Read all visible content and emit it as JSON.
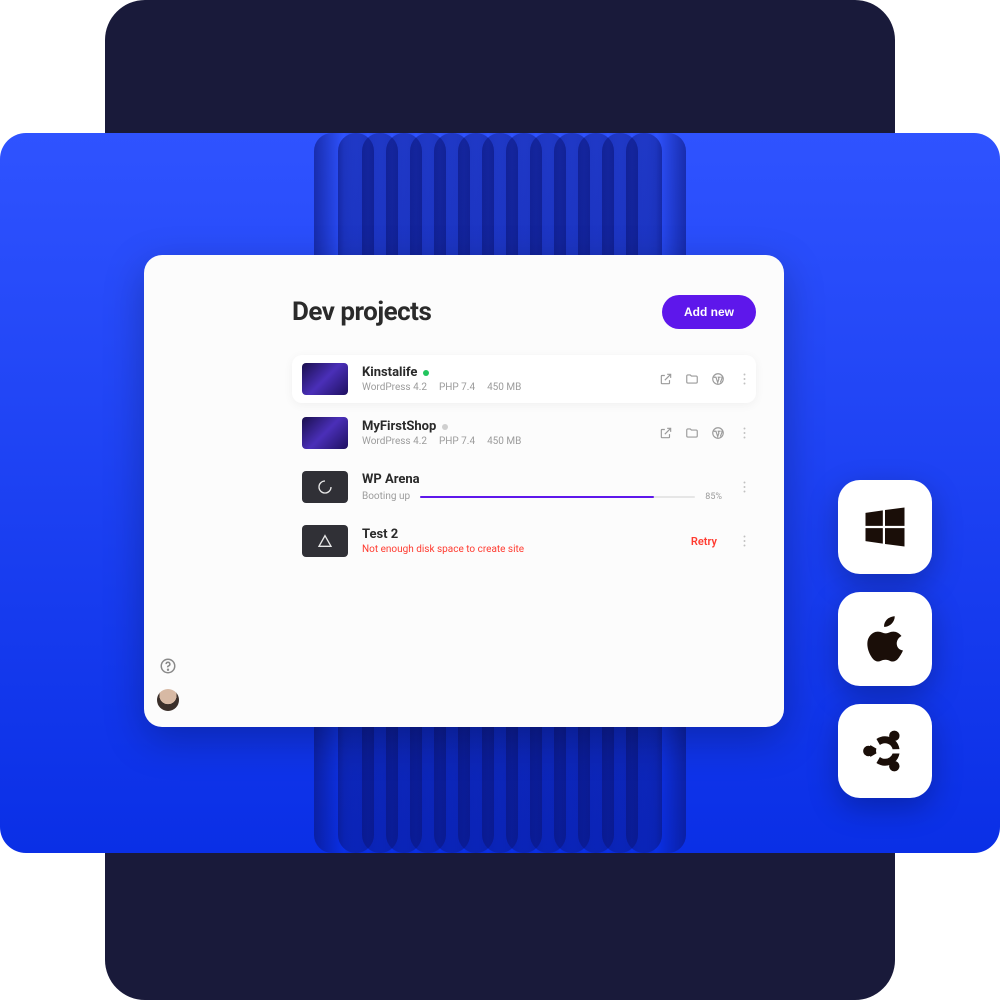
{
  "header": {
    "title": "Dev projects",
    "add_button": "Add new"
  },
  "projects": [
    {
      "name": "Kinstalife",
      "status": "green",
      "meta": {
        "wp": "WordPress 4.2",
        "php": "PHP 7.4",
        "size": "450 MB"
      }
    },
    {
      "name": "MyFirstShop",
      "status": "grey",
      "meta": {
        "wp": "WordPress 4.2",
        "php": "PHP 7.4",
        "size": "450 MB"
      }
    },
    {
      "name": "WP Arena",
      "booting_label": "Booting up",
      "progress_pct": "85%",
      "progress_value": 85
    },
    {
      "name": "Test 2",
      "error": "Not enough disk space to create site",
      "retry_label": "Retry"
    }
  ],
  "os_badges": [
    "windows",
    "apple",
    "ubuntu"
  ]
}
